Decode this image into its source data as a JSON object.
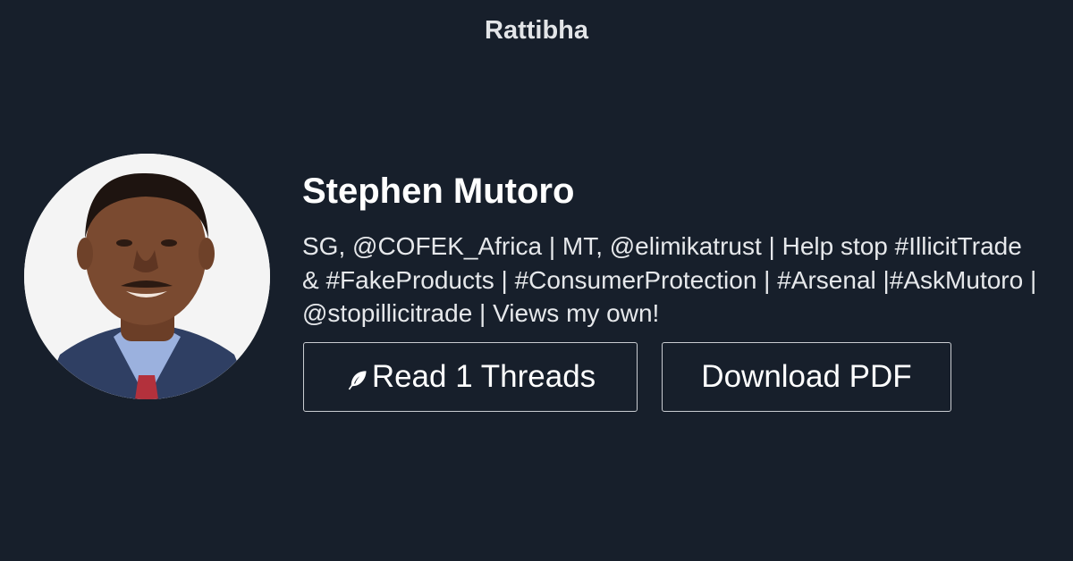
{
  "header": {
    "brand": "Rattibha"
  },
  "profile": {
    "name": "Stephen Mutoro",
    "bio": "SG, @COFEK_Africa | MT, @elimikatrust | Help stop #IllicitTrade & #FakeProducts | #ConsumerProtection | #Arsenal |#AskMutoro | @stopillicitrade | Views my own!",
    "avatar_icon": "profile-photo"
  },
  "actions": {
    "read_label": "Read 1 Threads",
    "read_icon": "feather-icon",
    "pdf_label": "Download PDF"
  },
  "colors": {
    "background": "#171f2b",
    "text": "#ffffff",
    "border": "#c9ccd1"
  }
}
